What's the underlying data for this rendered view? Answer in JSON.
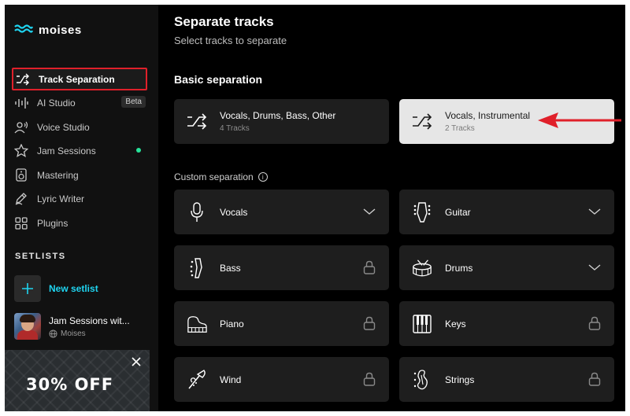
{
  "app": {
    "logo_text": "moises"
  },
  "sidebar": {
    "items": [
      {
        "label": "Track Separation",
        "icon": "split-icon",
        "active": true
      },
      {
        "label": "AI Studio",
        "icon": "waveform-icon",
        "badge": "Beta"
      },
      {
        "label": "Voice Studio",
        "icon": "voice-icon"
      },
      {
        "label": "Jam Sessions",
        "icon": "star-icon",
        "dot": true
      },
      {
        "label": "Mastering",
        "icon": "speaker-icon"
      },
      {
        "label": "Lyric Writer",
        "icon": "pen-icon"
      },
      {
        "label": "Plugins",
        "icon": "grid-icon"
      }
    ],
    "setlists_label": "SETLISTS",
    "new_setlist": "New setlist",
    "setlist": {
      "title": "Jam Sessions wit...",
      "owner": "Moises"
    },
    "promo": {
      "text": "30% OFF"
    }
  },
  "main": {
    "title": "Separate tracks",
    "subtitle": "Select tracks to separate",
    "basic_heading": "Basic separation",
    "basic_options": [
      {
        "title": "Vocals, Drums, Bass, Other",
        "sub": "4 Tracks"
      },
      {
        "title": "Vocals, Instrumental",
        "sub": "2 Tracks",
        "selected": true
      }
    ],
    "custom_heading": "Custom separation",
    "tracks": [
      {
        "label": "Vocals",
        "icon": "microphone-icon",
        "state": "expand"
      },
      {
        "label": "Guitar",
        "icon": "guitar-head-icon",
        "state": "expand"
      },
      {
        "label": "Bass",
        "icon": "bass-head-icon",
        "state": "locked"
      },
      {
        "label": "Drums",
        "icon": "drum-icon",
        "state": "expand"
      },
      {
        "label": "Piano",
        "icon": "piano-icon",
        "state": "locked"
      },
      {
        "label": "Keys",
        "icon": "keys-icon",
        "state": "locked"
      },
      {
        "label": "Wind",
        "icon": "trumpet-icon",
        "state": "locked"
      },
      {
        "label": "Strings",
        "icon": "violin-icon",
        "state": "locked"
      }
    ]
  },
  "colors": {
    "active_outline": "#e0202a",
    "accent": "#1fd4f0",
    "online_dot": "#27e39a",
    "arrow": "#e0202a"
  }
}
